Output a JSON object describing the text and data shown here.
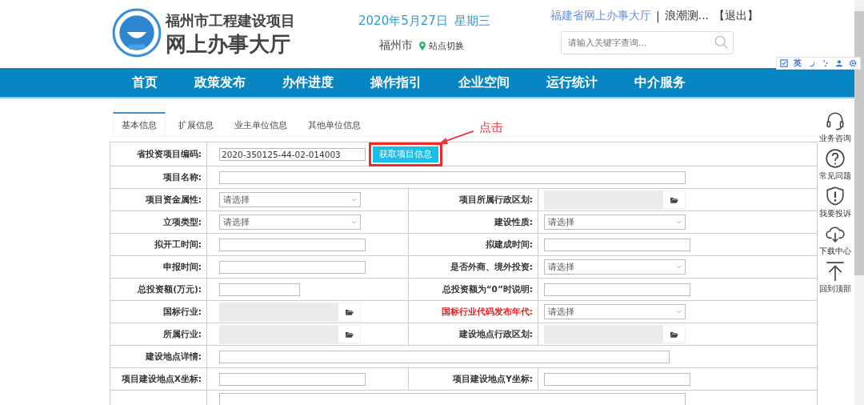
{
  "header": {
    "title_line1": "福州市工程建设项目",
    "title_line2": "网上办事大厅",
    "date": "2020年5月27日",
    "weekday": "星期三",
    "city": "福州市",
    "switch_site": "站点切换",
    "portal_link": "福建省网上办事大厅",
    "separator": "|",
    "user": "浪潮测...",
    "logout": "【退出】",
    "search": {
      "placeholder": "请输入关键字查询..."
    }
  },
  "accessibility_toolbar": {
    "language": "英"
  },
  "nav": [
    {
      "label": "首页"
    },
    {
      "label": "政策发布"
    },
    {
      "label": "办件进度"
    },
    {
      "label": "操作指引"
    },
    {
      "label": "企业空间"
    },
    {
      "label": "运行统计"
    },
    {
      "label": "中介服务"
    }
  ],
  "tabs": [
    {
      "label": "基本信息",
      "selected": true
    },
    {
      "label": "扩展信息",
      "selected": false
    },
    {
      "label": "业主单位信息",
      "selected": false
    },
    {
      "label": "其他单位信息",
      "selected": false
    }
  ],
  "form": {
    "rows": [
      {
        "kind": "wide",
        "cells": [
          {
            "label": "省投资项目编码:",
            "required": false,
            "field": {
              "kind": "text",
              "value": "2020-350125-44-02-014003"
            },
            "button": {
              "label": "获取项目信息",
              "highlighted": true
            }
          }
        ]
      },
      {
        "kind": "wide",
        "cells": [
          {
            "label": "项目名称:",
            "required": false,
            "field": {
              "kind": "text"
            }
          }
        ]
      },
      {
        "kind": "pair",
        "cells": [
          {
            "label": "项目资金属性:",
            "required": false,
            "field": {
              "kind": "select",
              "value": "请选择"
            }
          },
          {
            "label": "项目所属行政区划:",
            "required": false,
            "field": {
              "kind": "picker"
            }
          }
        ]
      },
      {
        "kind": "pair",
        "cells": [
          {
            "label": "立项类型:",
            "required": false,
            "field": {
              "kind": "select",
              "value": "请选择"
            }
          },
          {
            "label": "建设性质:",
            "required": false,
            "field": {
              "kind": "select",
              "value": "请选择"
            }
          }
        ]
      },
      {
        "kind": "pair",
        "cells": [
          {
            "label": "拟开工时间:",
            "required": false,
            "field": {
              "kind": "text"
            }
          },
          {
            "label": "拟建成时间:",
            "required": false,
            "field": {
              "kind": "text"
            }
          }
        ]
      },
      {
        "kind": "pair",
        "cells": [
          {
            "label": "申报时间:",
            "required": false,
            "field": {
              "kind": "text"
            }
          },
          {
            "label": "是否外商、境外投资:",
            "required": false,
            "field": {
              "kind": "select",
              "value": "请选择"
            }
          }
        ]
      },
      {
        "kind": "pair",
        "cells": [
          {
            "label": "总投资额(万元):",
            "required": false,
            "field": {
              "kind": "text"
            }
          },
          {
            "label": "总投资额为“0”时说明:",
            "required": false,
            "field": {
              "kind": "text"
            }
          }
        ]
      },
      {
        "kind": "pair",
        "cells": [
          {
            "label": "国标行业:",
            "required": false,
            "field": {
              "kind": "picker"
            }
          },
          {
            "label": "国标行业代码发布年代:",
            "required": true,
            "field": {
              "kind": "select",
              "value": "请选择"
            }
          }
        ]
      },
      {
        "kind": "pair",
        "cells": [
          {
            "label": "所属行业:",
            "required": false,
            "field": {
              "kind": "picker"
            }
          },
          {
            "label": "建设地点行政区划:",
            "required": false,
            "field": {
              "kind": "picker"
            }
          }
        ]
      },
      {
        "kind": "wide",
        "cells": [
          {
            "label": "建设地点详情:",
            "required": false,
            "field": {
              "kind": "text"
            }
          }
        ]
      },
      {
        "kind": "pair",
        "cells": [
          {
            "label": "项目建设地点X坐标:",
            "required": false,
            "field": {
              "kind": "text"
            }
          },
          {
            "label": "项目建设地点Y坐标:",
            "required": false,
            "field": {
              "kind": "text"
            }
          }
        ]
      },
      {
        "kind": "wide",
        "cells": [
          {
            "field": {
              "kind": "textarea"
            }
          }
        ]
      }
    ]
  },
  "annotation": {
    "text": "点击"
  },
  "side_tools": [
    {
      "kind": "headset",
      "label": "业务咨询"
    },
    {
      "kind": "question",
      "label": "常见问题"
    },
    {
      "kind": "shield",
      "label": "我要投诉"
    },
    {
      "kind": "download",
      "label": "下载中心"
    },
    {
      "kind": "top",
      "label": "回到顶部"
    }
  ]
}
